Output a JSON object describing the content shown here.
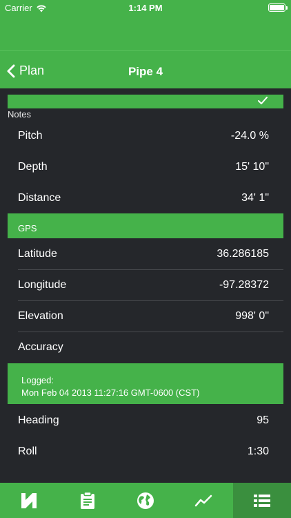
{
  "status": {
    "carrier": "Carrier",
    "time": "1:14 PM"
  },
  "nav": {
    "back_label": "Plan",
    "title": "Pipe 4"
  },
  "notes_label": "Notes",
  "measurements": [
    {
      "label": "Pitch",
      "value": "-24.0 %"
    },
    {
      "label": "Depth",
      "value": "15' 10\""
    },
    {
      "label": "Distance",
      "value": "34' 1\""
    }
  ],
  "gps": {
    "header": "GPS",
    "rows": [
      {
        "label": "Latitude",
        "value": "36.286185"
      },
      {
        "label": "Longitude",
        "value": "-97.28372"
      },
      {
        "label": "Elevation",
        "value": "998' 0\""
      },
      {
        "label": "Accuracy",
        "value": ""
      }
    ]
  },
  "logged": {
    "label": "Logged:",
    "value": "Mon Feb 04 2013 11:27:16 GMT-0600 (CST)"
  },
  "orientation": [
    {
      "label": "Heading",
      "value": "95"
    },
    {
      "label": "Roll",
      "value": "1:30"
    }
  ],
  "tabs": [
    {
      "icon": "logo-icon",
      "active": false
    },
    {
      "icon": "clipboard-icon",
      "active": false
    },
    {
      "icon": "globe-icon",
      "active": false
    },
    {
      "icon": "chart-line-icon",
      "active": false
    },
    {
      "icon": "list-icon",
      "active": true
    }
  ],
  "colors": {
    "accent": "#45b24a",
    "background": "#25272b",
    "active_tab": "#3a8f3e"
  }
}
